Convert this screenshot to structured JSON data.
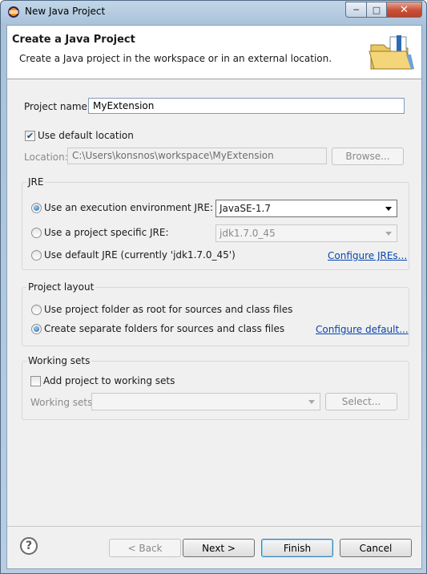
{
  "window": {
    "title": "New Java Project"
  },
  "header": {
    "title": "Create a Java Project",
    "description": "Create a Java project in the workspace or in an external location."
  },
  "project": {
    "name_label": "Project name:",
    "name_value": "MyExtension",
    "use_default_location_label": "Use default location",
    "use_default_location_checked": true,
    "location_label": "Location:",
    "location_value": "C:\\Users\\konsnos\\workspace\\MyExtension",
    "browse_label": "Browse..."
  },
  "jre": {
    "group_title": "JRE",
    "options": [
      {
        "label": "Use an execution environment JRE:",
        "selected": true
      },
      {
        "label": "Use a project specific JRE:",
        "selected": false
      },
      {
        "label": "Use default JRE (currently 'jdk1.7.0_45')",
        "selected": false
      }
    ],
    "execution_environment_value": "JavaSE-1.7",
    "project_specific_value": "jdk1.7.0_45",
    "configure_link": "Configure JREs..."
  },
  "layout": {
    "group_title": "Project layout",
    "options": [
      {
        "label": "Use project folder as root for sources and class files",
        "selected": false
      },
      {
        "label": "Create separate folders for sources and class files",
        "selected": true
      }
    ],
    "configure_link": "Configure default..."
  },
  "working_sets": {
    "group_title": "Working sets",
    "add_label": "Add project to working sets",
    "add_checked": false,
    "sets_label": "Working sets:",
    "sets_value": "",
    "select_label": "Select..."
  },
  "footer": {
    "help_icon": "help-icon",
    "back_label": "< Back",
    "next_label": "Next >",
    "finish_label": "Finish",
    "cancel_label": "Cancel"
  },
  "titlebar_buttons": {
    "minimize": "─",
    "maximize": "□",
    "close": "✕"
  }
}
